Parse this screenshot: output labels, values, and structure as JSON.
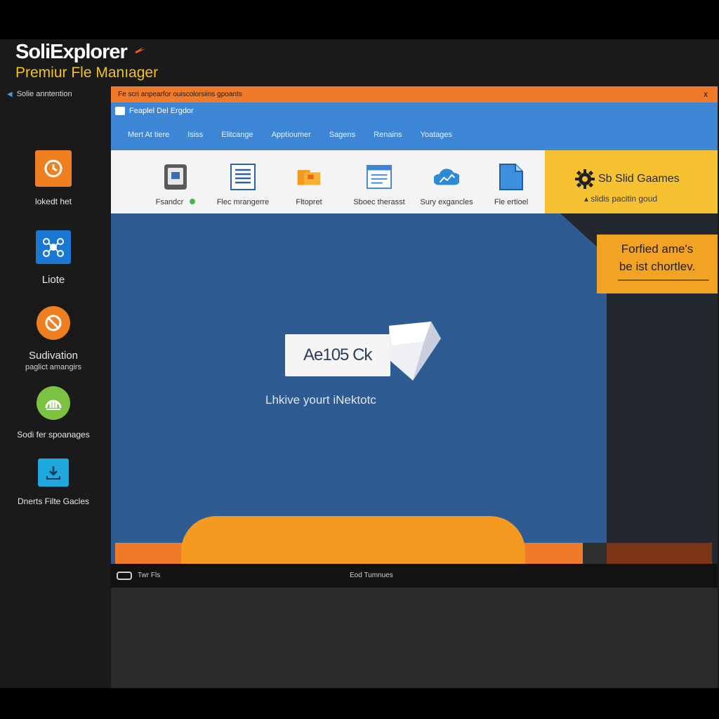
{
  "brand": {
    "title": "SoliExplorer",
    "subtitle": "Premiur Fle Manıager",
    "accent_color": "#f5c21b"
  },
  "sidebar": {
    "toggle_label": "Solie anntention",
    "items": [
      {
        "label": "lokedt het",
        "icon": "clock-icon",
        "color": "#f07f22"
      },
      {
        "label": "Liote",
        "icon": "network-icon",
        "color": "#1a78d4"
      },
      {
        "label": "Sudivation",
        "sub": "paglict amangirs",
        "icon": "ban-icon",
        "color": "#f07f22"
      },
      {
        "label": "Sodi fer spoanages",
        "icon": "gauge-icon",
        "color": "#7cc242"
      },
      {
        "label": "Dnerts Filte Gacles",
        "icon": "download-icon",
        "color": "#1fa8e0"
      }
    ]
  },
  "window": {
    "titlebar_text": "Fe scri anpearfor ouiscolorsiins gpoants",
    "close_glyph": "x",
    "app_name": "Feaplel Del Ergdor",
    "menu": [
      "Mert At tiere",
      "Isiss",
      "Elitcange",
      "Apptioumer",
      "Sagens",
      "Renains",
      "Yoatages"
    ],
    "tools": [
      {
        "label": "Fsandcr",
        "icon": "disk-icon"
      },
      {
        "label": "Flec mrangerre",
        "icon": "document-lines-icon"
      },
      {
        "label": "Fltopret",
        "icon": "folder-icon"
      },
      {
        "label": "Sboec therasst",
        "icon": "window-icon"
      },
      {
        "label": "Sury exgancles",
        "icon": "cloud-chart-icon"
      },
      {
        "label": "Fle ertioel",
        "icon": "file-icon"
      }
    ],
    "promo": {
      "title": "Sb Slid Gaames",
      "subtitle": "slidis pacitin goud"
    },
    "callout": {
      "line1": "Forfied ame's",
      "line2": "be ist chortlev."
    },
    "card_text": "Ae105 Ck",
    "tagline": "Lhkive yourt iNektotc"
  },
  "statusbar": {
    "left": "Twr Fls",
    "middle": "Eod Tumnues"
  }
}
